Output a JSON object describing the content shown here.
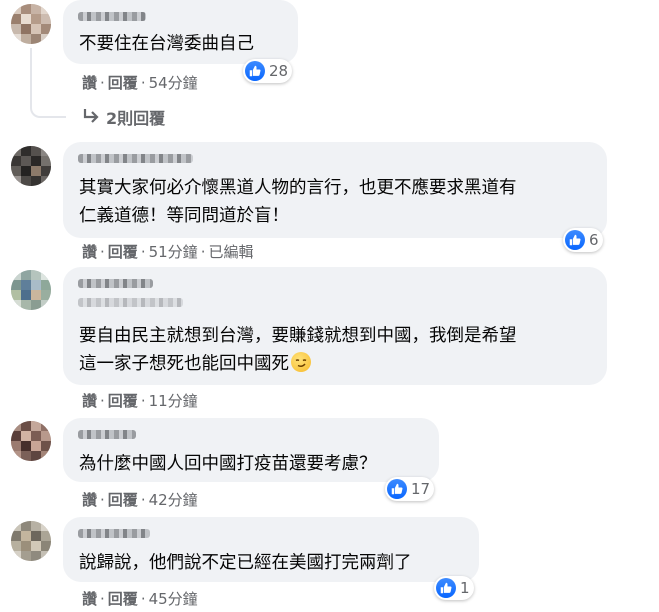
{
  "comments": [
    {
      "text_lines": [
        "不要住在台灣委曲自己"
      ],
      "actions": {
        "like": "讚",
        "reply": "回覆",
        "time": "54分鐘"
      },
      "reactions": "28",
      "replies_label": "2則回覆"
    },
    {
      "text_lines": [
        "其實大家何必介懷黑道人物的言行，也更不應要求黑道有",
        "仁義道德！等同問道於盲！"
      ],
      "actions": {
        "like": "讚",
        "reply": "回覆",
        "time": "51分鐘",
        "edited": "已編輯"
      },
      "reactions": "6"
    },
    {
      "text_lines": [
        "要自由民主就想到台灣，要賺錢就想到中國，我倒是希望",
        "這一家子想死也能回中國死"
      ],
      "actions": {
        "like": "讚",
        "reply": "回覆",
        "time": "11分鐘"
      }
    },
    {
      "text_lines": [
        "為什麼中國人回中國打疫苗還要考慮？"
      ],
      "actions": {
        "like": "讚",
        "reply": "回覆",
        "time": "42分鐘"
      },
      "reactions": "17"
    },
    {
      "text_lines": [
        "說歸說，他們說不定已經在美國打完兩劑了"
      ],
      "actions": {
        "like": "讚",
        "reply": "回覆",
        "time": "45分鐘"
      },
      "reactions": "1"
    }
  ],
  "separator": "·",
  "colors": {
    "bubble": "#f0f2f5",
    "meta": "#65676b",
    "like_blue": "#0866ff"
  },
  "icons": {
    "like": "thumbs-up-icon",
    "reply_arrow": "reply-arrow-icon",
    "emoji": "smirk-emoji-icon"
  }
}
